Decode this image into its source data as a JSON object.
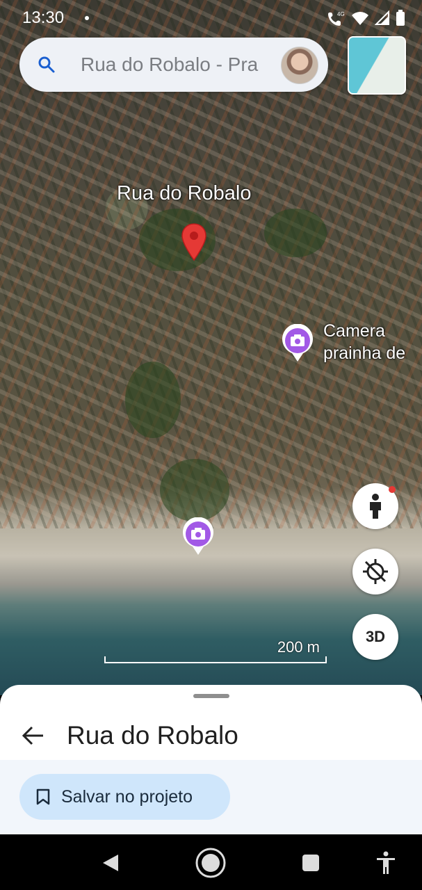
{
  "status_bar": {
    "time": "13:30",
    "network": "4G"
  },
  "search": {
    "value": "Rua do Robalo - Pra"
  },
  "map": {
    "street_label": "Rua do Robalo",
    "poi_label_line1": "Camera",
    "poi_label_line2": "prainha de",
    "scale_label": "200 m",
    "pin_color": "#e53935",
    "photo_pin_color": "#a259e6"
  },
  "controls": {
    "three_d_label": "3D"
  },
  "sheet": {
    "title": "Rua do Robalo",
    "save_label": "Salvar no projeto",
    "save_bg": "#cfe6fb"
  }
}
